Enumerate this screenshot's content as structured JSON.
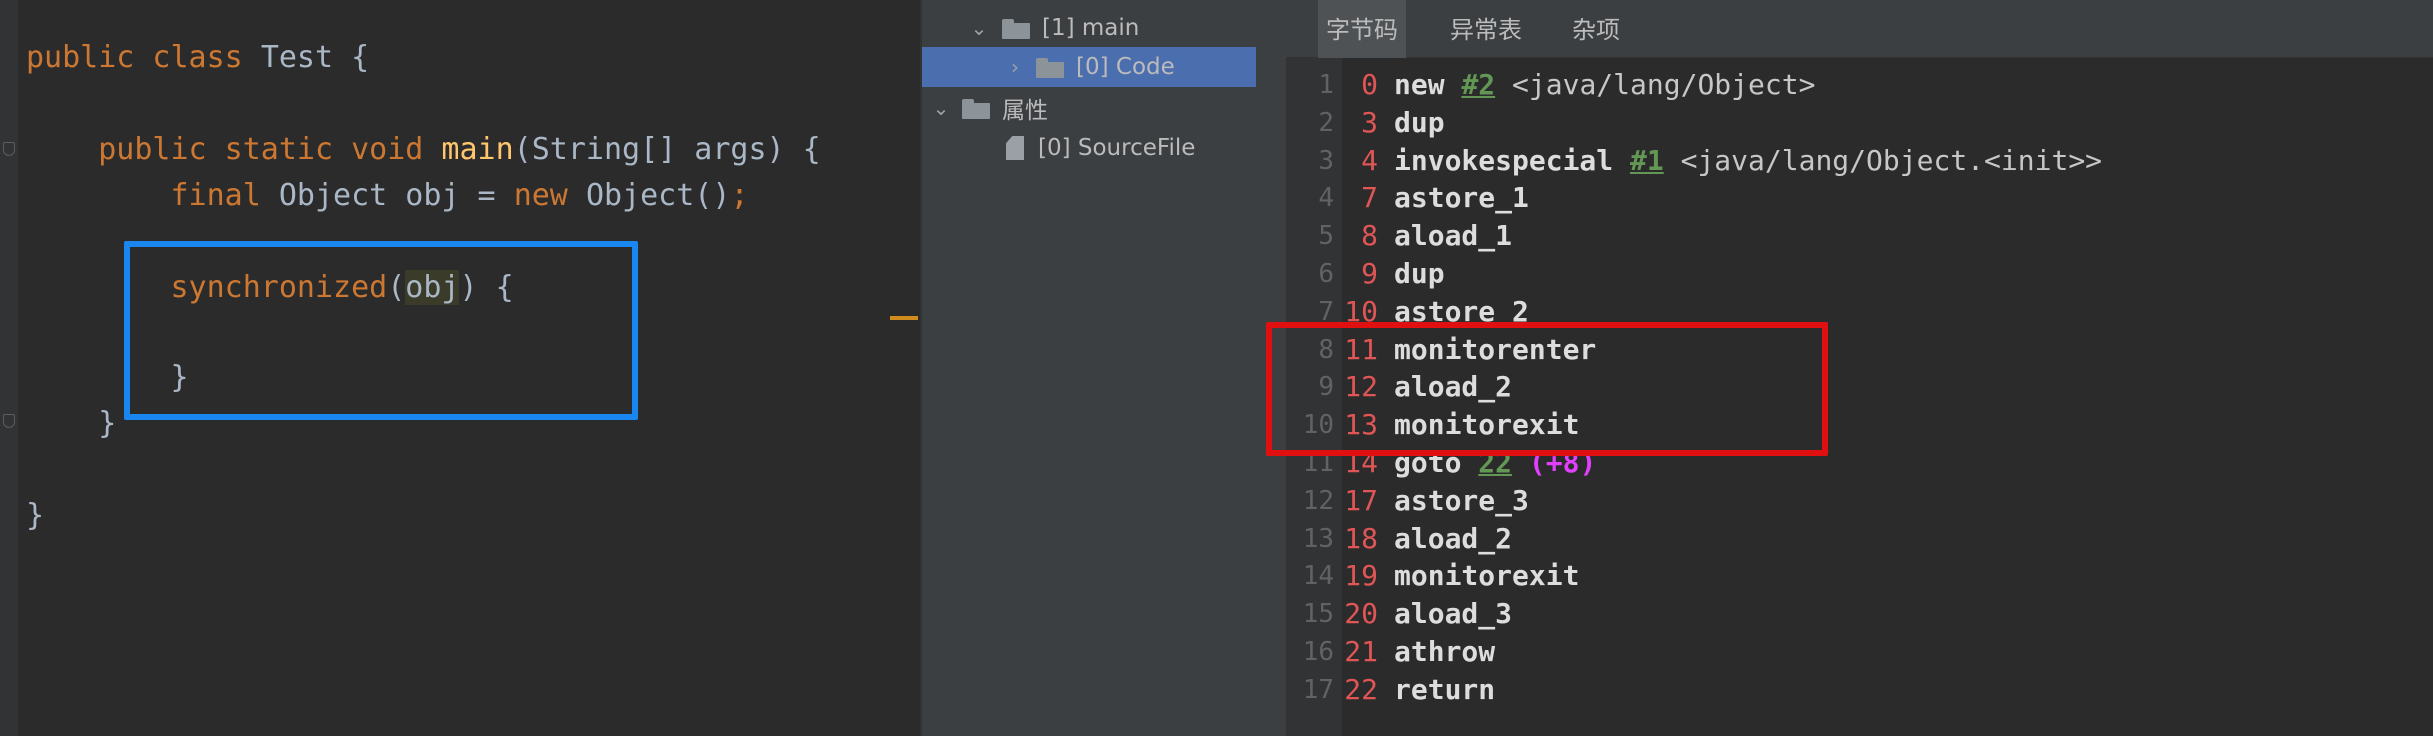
{
  "editor": {
    "lines": [
      {
        "parts": [
          {
            "t": "public class ",
            "c": "kw"
          },
          {
            "t": "Test {",
            "c": "txt"
          }
        ]
      },
      {
        "parts": [
          {
            "t": "    public static void ",
            "c": "kw"
          },
          {
            "t": "main",
            "c": "fn"
          },
          {
            "t": "(String[] args) {",
            "c": "txt"
          }
        ]
      },
      {
        "parts": [
          {
            "t": "        final ",
            "c": "kw"
          },
          {
            "t": "Object obj = ",
            "c": "txt"
          },
          {
            "t": "new ",
            "c": "kw"
          },
          {
            "t": "Object()",
            "c": "txt"
          },
          {
            "t": ";",
            "c": "semi"
          }
        ]
      },
      {
        "parts": [
          {
            "t": "        synchronized",
            "c": "kw"
          },
          {
            "t": "(",
            "c": "txt"
          },
          {
            "t": "obj",
            "c": "hl"
          },
          {
            "t": ") {",
            "c": "txt"
          }
        ]
      },
      {
        "parts": [
          {
            "t": "        }",
            "c": "txt"
          }
        ]
      },
      {
        "parts": [
          {
            "t": "    }",
            "c": "txt"
          }
        ]
      },
      {
        "parts": [
          {
            "t": "}",
            "c": "txt"
          }
        ]
      }
    ]
  },
  "tree": {
    "main_label": "[1] main",
    "code_label": "[0] Code",
    "attributes_label": "属性",
    "sourcefile_label": "[0] SourceFile"
  },
  "tabs": {
    "bytecode": "字节码",
    "exceptions": "异常表",
    "misc": "杂项"
  },
  "bytecode": [
    {
      "ln": "1",
      "off": "0",
      "op": "new",
      "ref": "#2",
      "arg": "<java/lang/Object>"
    },
    {
      "ln": "2",
      "off": "3",
      "op": "dup"
    },
    {
      "ln": "3",
      "off": "4",
      "op": "invokespecial",
      "ref": "#1",
      "arg": "<java/lang/Object.<init>>"
    },
    {
      "ln": "4",
      "off": "7",
      "op": "astore_1"
    },
    {
      "ln": "5",
      "off": "8",
      "op": "aload_1"
    },
    {
      "ln": "6",
      "off": "9",
      "op": "dup"
    },
    {
      "ln": "7",
      "off": "10",
      "op": "astore_2"
    },
    {
      "ln": "8",
      "off": "11",
      "op": "monitorenter"
    },
    {
      "ln": "9",
      "off": "12",
      "op": "aload_2"
    },
    {
      "ln": "10",
      "off": "13",
      "op": "monitorexit"
    },
    {
      "ln": "11",
      "off": "14",
      "op": "goto",
      "ref": "22",
      "jmp": "(+8)"
    },
    {
      "ln": "12",
      "off": "17",
      "op": "astore_3"
    },
    {
      "ln": "13",
      "off": "18",
      "op": "aload_2"
    },
    {
      "ln": "14",
      "off": "19",
      "op": "monitorexit"
    },
    {
      "ln": "15",
      "off": "20",
      "op": "aload_3"
    },
    {
      "ln": "16",
      "off": "21",
      "op": "athrow"
    },
    {
      "ln": "17",
      "off": "22",
      "op": "return"
    }
  ],
  "colors": {
    "highlight_box_blue": "#1a86f0",
    "highlight_box_red": "#e01010",
    "keyword": "#cc7832",
    "function": "#ffc66d",
    "offset": "#e05555",
    "reference": "#629755",
    "jump": "#e040fb"
  }
}
